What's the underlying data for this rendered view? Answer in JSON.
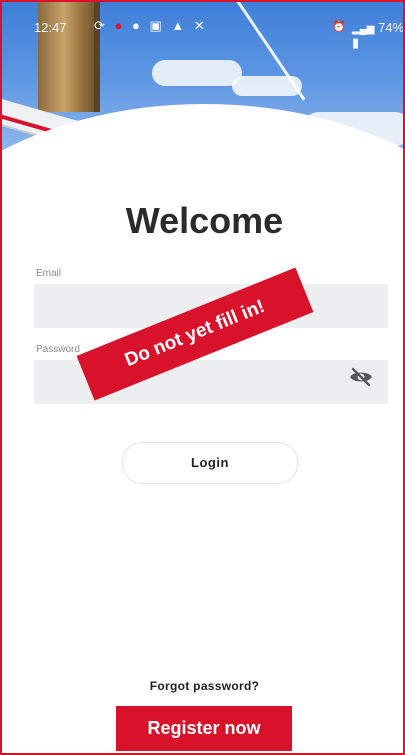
{
  "status_bar": {
    "time": "12:47",
    "battery": "74%",
    "left_icons": [
      "sync-icon",
      "notification-icon",
      "mail-icon",
      "gallery-icon",
      "warning-icon",
      "signal-off-icon"
    ],
    "right_icons": [
      "alarm-icon",
      "wifi-icon",
      "signal-icon",
      "battery-icon"
    ]
  },
  "header": {
    "title": "Welcome"
  },
  "form": {
    "email_label": "Email",
    "email_value": "",
    "password_label": "Password",
    "password_value": "",
    "login_label": "Login"
  },
  "overlay": {
    "banner_text": "Do not yet fill in!"
  },
  "footer": {
    "forgot_label": "Forgot password?",
    "register_label": "Register now"
  },
  "colors": {
    "accent": "#d9122c",
    "field_bg": "#eceef0",
    "title": "#2b2b2b"
  }
}
